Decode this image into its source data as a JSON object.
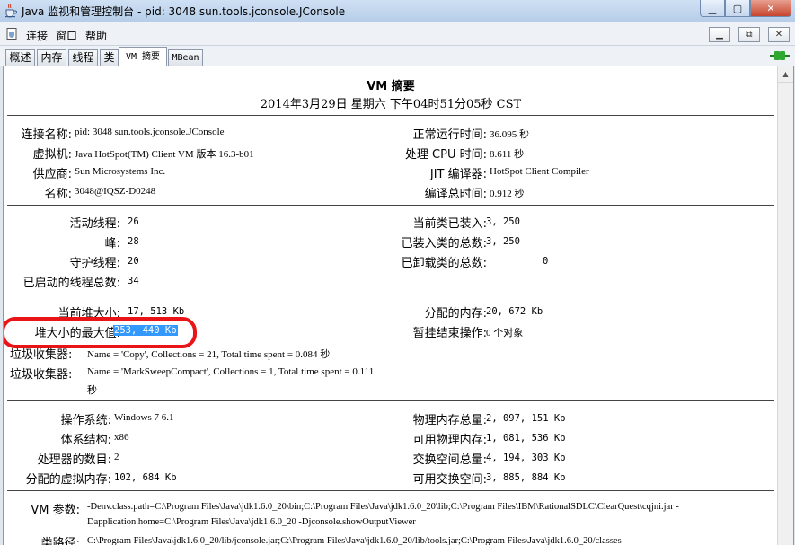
{
  "window": {
    "title": "Java 监视和管理控制台 - pid: 3048 sun.tools.jconsole.JConsole",
    "buttons": {
      "minimize": "▁",
      "maximize": "▢",
      "close": "✕"
    }
  },
  "menu": {
    "items": [
      "连接",
      "窗口",
      "帮助"
    ],
    "mdi": {
      "minimize": "▁",
      "restore": "⧉",
      "close": "✕"
    }
  },
  "tabs": [
    {
      "label": "概述"
    },
    {
      "label": "内存"
    },
    {
      "label": "线程"
    },
    {
      "label": "类"
    },
    {
      "label": "VM 摘要"
    },
    {
      "label": "MBean"
    }
  ],
  "active_tab": "VM 摘要",
  "summary": {
    "title": "VM 摘要",
    "datetime": "2014年3月29日 星期六 下午04时51分05秒 CST"
  },
  "section1": {
    "left": [
      {
        "label": "连接名称:",
        "value": "pid: 3048 sun.tools.jconsole.JConsole"
      },
      {
        "label": "虚拟机:",
        "value": "Java HotSpot(TM) Client VM 版本 16.3-b01"
      },
      {
        "label": "供应商:",
        "value": "Sun Microsystems Inc."
      },
      {
        "label": "名称:",
        "value": "3048@IQSZ-D0248"
      }
    ],
    "right": [
      {
        "label": "正常运行时间:",
        "value": "36.095 秒"
      },
      {
        "label": "处理 CPU 时间:",
        "value": "8.611 秒"
      },
      {
        "label": "JIT 编译器:",
        "value": "HotSpot Client Compiler"
      },
      {
        "label": "编译总时间:",
        "value": "0.912 秒"
      }
    ]
  },
  "section2": {
    "left": [
      {
        "label": "活动线程:",
        "value": "26"
      },
      {
        "label": "峰:",
        "value": "28"
      },
      {
        "label": "守护线程:",
        "value": "20"
      },
      {
        "label": "已启动的线程总数:",
        "value": "34"
      }
    ],
    "right": [
      {
        "label": "当前类已装入:",
        "value": "3, 250"
      },
      {
        "label": "已装入类的总数:",
        "value": "3, 250"
      },
      {
        "label": "已卸载类的总数:",
        "value": "0"
      }
    ]
  },
  "section3": {
    "left": [
      {
        "label": "当前堆大小:",
        "value": "17, 513 Kb"
      },
      {
        "label": "堆大小的最大值:",
        "value": "253, 440 Kb"
      }
    ],
    "right": [
      {
        "label": "分配的内存:",
        "value": "20, 672 Kb"
      },
      {
        "label": "暂挂结束操作:",
        "value": "0 个对象"
      }
    ],
    "gc": [
      {
        "label": "垃圾收集器:",
        "value": "Name = 'Copy', Collections = 21, Total time spent = 0.084 秒"
      },
      {
        "label": "垃圾收集器:",
        "value": "Name = 'MarkSweepCompact', Collections = 1, Total time spent = 0.111",
        "value2": "秒"
      }
    ]
  },
  "section4": {
    "left": [
      {
        "label": "操作系统:",
        "value": "Windows 7 6.1"
      },
      {
        "label": "体系结构:",
        "value": "x86"
      },
      {
        "label": "处理器的数目:",
        "value": "2"
      },
      {
        "label": "分配的虚拟内存:",
        "value": "102, 684 Kb"
      }
    ],
    "right": [
      {
        "label": "物理内存总量:",
        "value": "2, 097, 151 Kb"
      },
      {
        "label": "可用物理内存:",
        "value": "1, 081, 536 Kb"
      },
      {
        "label": "交换空间总量:",
        "value": "4, 194, 303 Kb"
      },
      {
        "label": "可用交换空间:",
        "value": "3, 885, 884 Kb"
      }
    ]
  },
  "section5": {
    "vm_args_label": "VM 参数:",
    "vm_args_line1": "-Denv.class.path=C:\\Program Files\\Java\\jdk1.6.0_20\\bin;C:\\Program Files\\Java\\jdk1.6.0_20\\lib;C:\\Program Files\\IBM\\RationalSDLC\\ClearQuest\\cqjni.jar -",
    "vm_args_line2": "Dapplication.home=C:\\Program Files\\Java\\jdk1.6.0_20 -Djconsole.showOutputViewer",
    "classpath_label": "类路径:",
    "classpath_line1": "C:\\Program Files\\Java\\jdk1.6.0_20/lib/jconsole.jar;C:\\Program Files\\Java\\jdk1.6.0_20/lib/tools.jar;C:\\Program Files\\Java\\jdk1.6.0_20/classes"
  },
  "colors": {
    "selection": "#3399ff",
    "annotation": "#e81418"
  }
}
